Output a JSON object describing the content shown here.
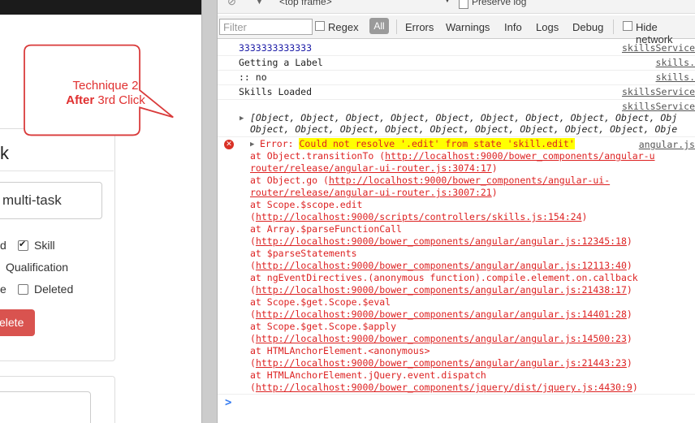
{
  "left_app": {
    "panel_title": "k",
    "task_input_value": "multi-task",
    "options": {
      "row1_label": "d",
      "skill_label": "Skill",
      "qualification_label": "Qualification",
      "row3_label": "e",
      "deleted_label": "Deleted"
    },
    "delete_button": "elete"
  },
  "callout": {
    "line1": "Technique 2",
    "line2_bold": "After",
    "line2_rest": " 3rd Click"
  },
  "devtools": {
    "top_frame": "<top frame>",
    "preserve_log": "Preserve log",
    "filter_placeholder": "Filter",
    "regex_label": "Regex",
    "levels": [
      "All",
      "Errors",
      "Warnings",
      "Info",
      "Logs",
      "Debug"
    ],
    "hide_network": "Hide network",
    "messages": [
      {
        "text": "3333333333333",
        "source": "skillsService"
      },
      {
        "text": "Getting a Label",
        "source": "skills."
      },
      {
        "text": ":: no",
        "source": "skills."
      },
      {
        "text": "Skills Loaded",
        "source": "skillsService"
      },
      {
        "text": "",
        "source": "skillsService"
      }
    ],
    "object_line1": "[Object, Object, Object, Object, Object, Object, Object, Object, Object, Obj",
    "object_line2": "Object, Object, Object, Object, Object, Object, Object, Object, Object, Obje",
    "error": {
      "prefix": "Error: ",
      "message": "Could not resolve '.edit' from state 'skill.edit'",
      "source": "angular.js",
      "stack": [
        {
          "pre": "    at Object.transitionTo (",
          "link": "http://localhost:9000/bower_components/angular-u",
          "post": ""
        },
        {
          "pre": "",
          "link": "router/release/angular-ui-router.js:3074:17",
          "post": ")"
        },
        {
          "pre": "    at Object.go (",
          "link": "http://localhost:9000/bower_components/angular-ui-",
          "post": ""
        },
        {
          "pre": "",
          "link": "router/release/angular-ui-router.js:3007:21",
          "post": ")"
        },
        {
          "pre": "    at Scope.$scope.edit",
          "link": "",
          "post": ""
        },
        {
          "pre": "(",
          "link": "http://localhost:9000/scripts/controllers/skills.js:154:24",
          "post": ")"
        },
        {
          "pre": "    at Array.$parseFunctionCall",
          "link": "",
          "post": ""
        },
        {
          "pre": "(",
          "link": "http://localhost:9000/bower_components/angular/angular.js:12345:18",
          "post": ")"
        },
        {
          "pre": "    at $parseStatements",
          "link": "",
          "post": ""
        },
        {
          "pre": "(",
          "link": "http://localhost:9000/bower_components/angular/angular.js:12113:40",
          "post": ")"
        },
        {
          "pre": "    at ngEventDirectives.(anonymous function).compile.element.on.callback",
          "link": "",
          "post": ""
        },
        {
          "pre": "(",
          "link": "http://localhost:9000/bower_components/angular/angular.js:21438:17",
          "post": ")"
        },
        {
          "pre": "    at Scope.$get.Scope.$eval",
          "link": "",
          "post": ""
        },
        {
          "pre": "(",
          "link": "http://localhost:9000/bower_components/angular/angular.js:14401:28",
          "post": ")"
        },
        {
          "pre": "    at Scope.$get.Scope.$apply",
          "link": "",
          "post": ""
        },
        {
          "pre": "(",
          "link": "http://localhost:9000/bower_components/angular/angular.js:14500:23",
          "post": ")"
        },
        {
          "pre": "    at HTMLAnchorElement.<anonymous>",
          "link": "",
          "post": ""
        },
        {
          "pre": "(",
          "link": "http://localhost:9000/bower_components/angular/angular.js:21443:23",
          "post": ")"
        },
        {
          "pre": "    at HTMLAnchorElement.jQuery.event.dispatch",
          "link": "",
          "post": ""
        },
        {
          "pre": "(",
          "link": "http://localhost:9000/bower_components/jquery/dist/jquery.js:4430:9",
          "post": ")"
        }
      ]
    },
    "prompt_symbol": ">"
  },
  "colors": {
    "error_red": "#dd2222",
    "highlight": "#ffff00",
    "delete_button": "#d9534f",
    "callout_border": "#d93a3a",
    "prompt_blue": "#367cf1",
    "message_blue": "#1a1aa6"
  }
}
